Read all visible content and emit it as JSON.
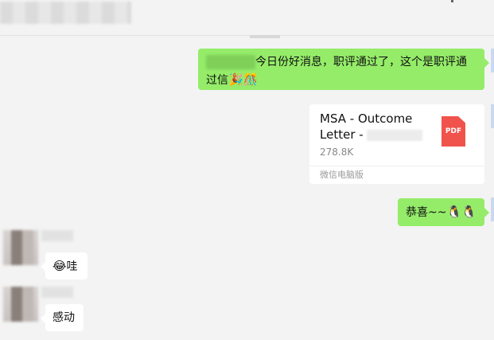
{
  "messages": {
    "m1": {
      "text": "今日份好消息，职评通过了，这个是职评通过信",
      "trailing_emoji": "🎉🎊"
    },
    "file": {
      "name": "MSA - Outcome Letter - ",
      "size": "278.8K",
      "source": "微信电脑版",
      "type_label": "PDF"
    },
    "m3": {
      "text": "恭喜~~",
      "emoji": "🐧🐧"
    },
    "m4": {
      "emoji": "😂",
      "text": "哇"
    },
    "m5": {
      "text": "感动"
    }
  },
  "colors": {
    "sent_bubble": "#95ec69",
    "received_bubble": "#ffffff",
    "background": "#f3f3f3",
    "pdf_red": "#f0534b"
  }
}
